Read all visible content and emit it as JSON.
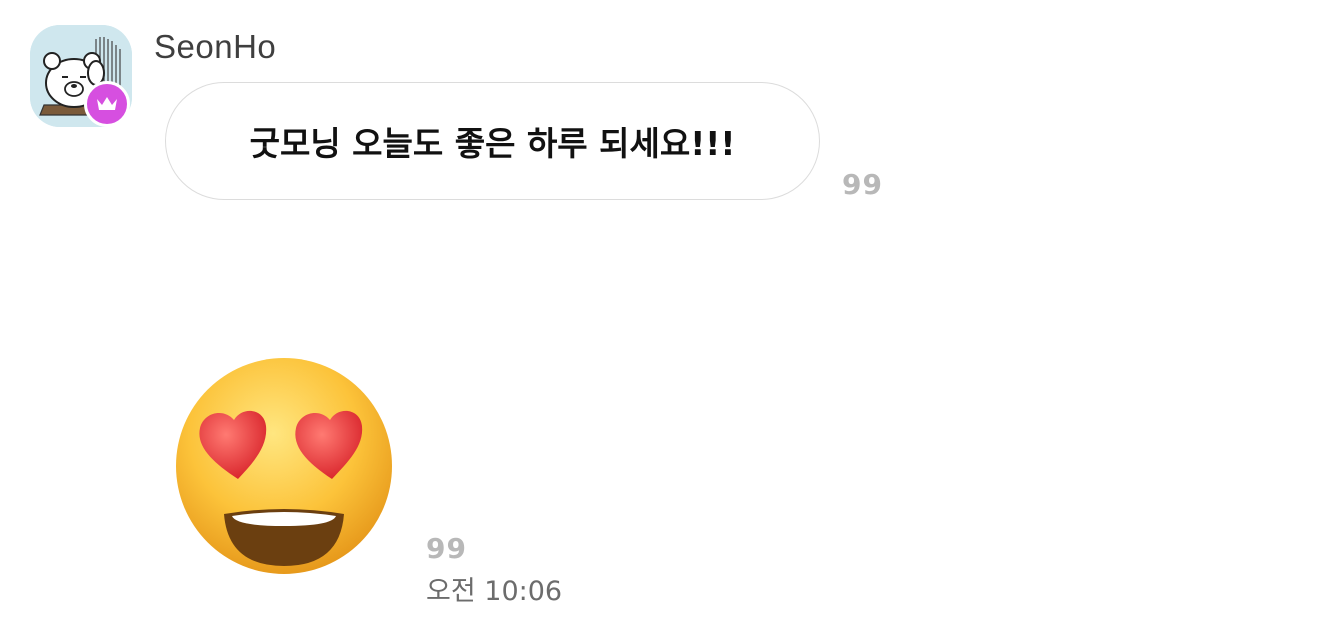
{
  "sender": {
    "name": "SeonHo",
    "avatar_icon": "bear-character-avatar",
    "badge_icon": "crown-icon",
    "badge_color": "#d64fe0"
  },
  "messages": [
    {
      "type": "text",
      "text": "굿모닝 오늘도 좋은 하루 되세요!!!",
      "unread_count": "99"
    },
    {
      "type": "emoji",
      "emoji_icon": "heart-eyes-emoji",
      "unread_count": "99",
      "time": "오전 10:06"
    }
  ],
  "colors": {
    "bubble_border": "#dcdcdc",
    "unread": "#b8b8b8",
    "timestamp": "#6c6c6c",
    "name": "#3f3f3f"
  }
}
